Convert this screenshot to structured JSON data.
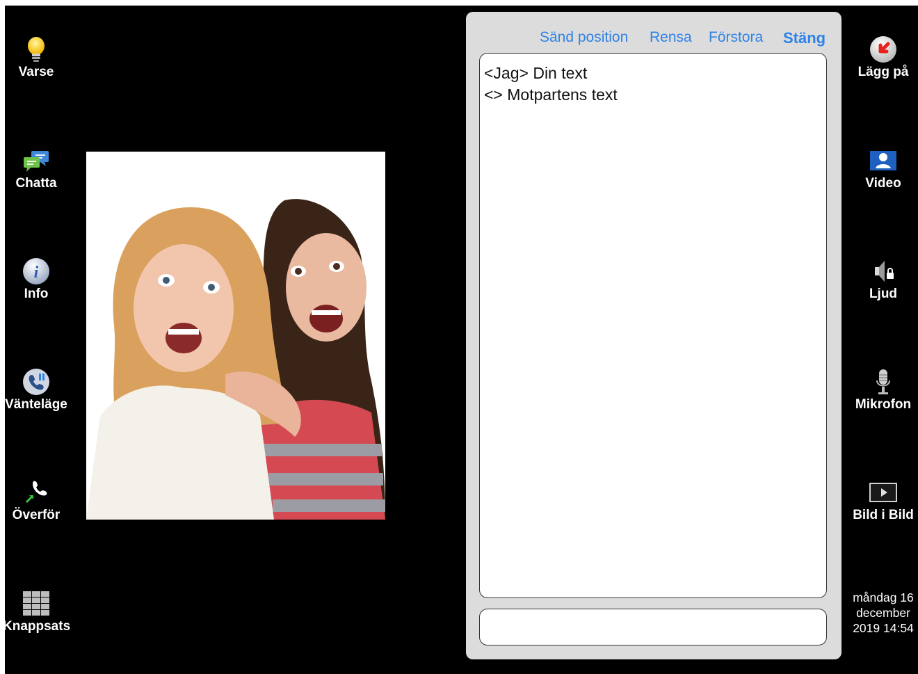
{
  "left_buttons": [
    {
      "label": "Varse",
      "icon": "lightbulb-icon"
    },
    {
      "label": "Chatta",
      "icon": "chat-bubbles-icon"
    },
    {
      "label": "Info",
      "icon": "info-icon"
    },
    {
      "label": "Vänteläge",
      "icon": "phone-hold-icon"
    },
    {
      "label": "Överför",
      "icon": "call-transfer-icon"
    },
    {
      "label": "Knappsats",
      "icon": "keypad-icon"
    }
  ],
  "right_buttons": [
    {
      "label": "Lägg på",
      "icon": "hang-up-icon"
    },
    {
      "label": "Video",
      "icon": "video-person-icon"
    },
    {
      "label": "Ljud",
      "icon": "speaker-locked-icon"
    },
    {
      "label": "Mikrofon",
      "icon": "microphone-icon"
    },
    {
      "label": "Bild i Bild",
      "icon": "picture-in-picture-icon"
    }
  ],
  "chat": {
    "toolbar": {
      "send_position": "Sänd position",
      "clear": "Rensa",
      "enlarge": "Förstora",
      "close": "Stäng"
    },
    "lines": [
      "<Jag> Din text",
      "<> Motpartens text"
    ],
    "input_value": ""
  },
  "datetime": {
    "line1": "måndag 16",
    "line2": "december",
    "line3": "2019 14:54"
  },
  "colors": {
    "background": "#000000",
    "panel": "#dcdcdc",
    "link": "#2f83e6"
  }
}
